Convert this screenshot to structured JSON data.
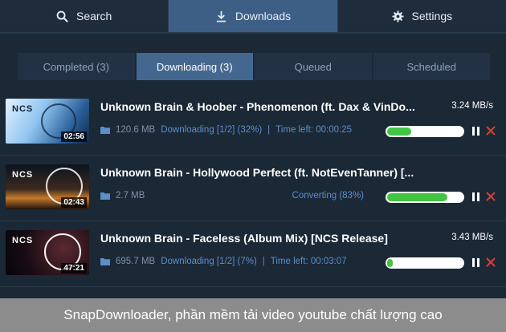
{
  "nav": {
    "search": "Search",
    "downloads": "Downloads",
    "settings": "Settings"
  },
  "tabs": [
    {
      "label": "Completed (3)"
    },
    {
      "label": "Downloading (3)"
    },
    {
      "label": "Queued"
    },
    {
      "label": "Scheduled"
    }
  ],
  "downloads": [
    {
      "title": "Unknown Brain & Hoober - Phenomenon (ft. Dax & VinDo...",
      "speed": "3.24 MB/s",
      "size": "120.6 MB",
      "status": "Downloading [1/2] (32%)",
      "time_left": "Time left: 00:00:25",
      "duration": "02:56",
      "thumb_label": "NCS",
      "progress": 0.32
    },
    {
      "title": "Unknown Brain - Hollywood Perfect (ft. NotEvenTanner) [...",
      "speed": "",
      "size": "2.7 MB",
      "status": "Converting (83%)",
      "time_left": "",
      "duration": "02:43",
      "thumb_label": "NCS",
      "progress": 0.8
    },
    {
      "title": "Unknown Brain - Faceless (Album Mix) [NCS Release]",
      "speed": "3.43 MB/s",
      "size": "695.7 MB",
      "status": "Downloading [1/2] (7%)",
      "time_left": "Time left: 00:03:07",
      "duration": "47:21",
      "thumb_label": "NCS",
      "progress": 0.07
    }
  ],
  "separator": "|",
  "caption": "SnapDownloader, phần mềm tải video youtube chất lượng cao",
  "colors": {
    "background": "#1b2836",
    "active_nav": "#3d5f86",
    "active_tab": "#44678f",
    "progress_fill": "#43c443",
    "status_text": "#5c8fc9",
    "cancel_red": "#e03a2e"
  }
}
